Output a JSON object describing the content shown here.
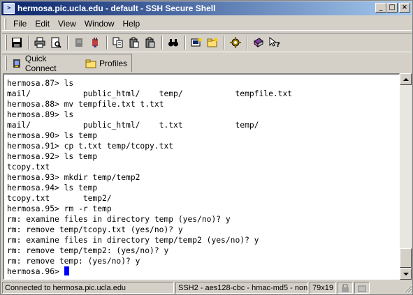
{
  "window": {
    "title": "hermosa.pic.ucla.edu - default - SSH Secure Shell",
    "buttons": {
      "minimize": "_",
      "maximize": "□",
      "close": "×"
    }
  },
  "menubar": {
    "items": [
      {
        "label": "File"
      },
      {
        "label": "Edit"
      },
      {
        "label": "View"
      },
      {
        "label": "Window"
      },
      {
        "label": "Help"
      }
    ]
  },
  "toolbar": {
    "icons": [
      "save-icon",
      "print-icon",
      "print-preview-icon",
      "profile-icon",
      "disconnect-icon",
      "copy-icon",
      "paste-icon",
      "paste-alt-icon",
      "find-icon",
      "new-terminal-icon",
      "new-file-transfer-icon",
      "settings-icon",
      "help-book-icon",
      "context-help-icon"
    ]
  },
  "profilebar": {
    "quick_connect": "Quick Connect",
    "profiles": "Profiles"
  },
  "terminal": {
    "lines": [
      "hermosa.87> ls",
      "mail/           public_html/    temp/           tempfile.txt",
      "hermosa.88> mv tempfile.txt t.txt",
      "hermosa.89> ls",
      "mail/           public_html/    t.txt           temp/",
      "hermosa.90> ls temp",
      "hermosa.91> cp t.txt temp/tcopy.txt",
      "hermosa.92> ls temp",
      "tcopy.txt",
      "hermosa.93> mkdir temp/temp2",
      "hermosa.94> ls temp",
      "tcopy.txt       temp2/",
      "hermosa.95> rm -r temp",
      "rm: examine files in directory temp (yes/no)? y",
      "rm: remove temp/tcopy.txt (yes/no)? y",
      "rm: examine files in directory temp/temp2 (yes/no)? y",
      "rm: remove temp/temp2: (yes/no)? y",
      "rm: remove temp: (yes/no)? y"
    ],
    "prompt": "hermosa.96> ",
    "cursor_color": "#0000ff"
  },
  "statusbar": {
    "connection": "Connected to hermosa.pic.ucla.edu",
    "cipher": "SSH2 - aes128-cbc - hmac-md5 - none",
    "size": "79x19"
  },
  "colors": {
    "title_start": "#0a246a",
    "title_end": "#a6caf0",
    "chrome": "#d4d0c8"
  }
}
